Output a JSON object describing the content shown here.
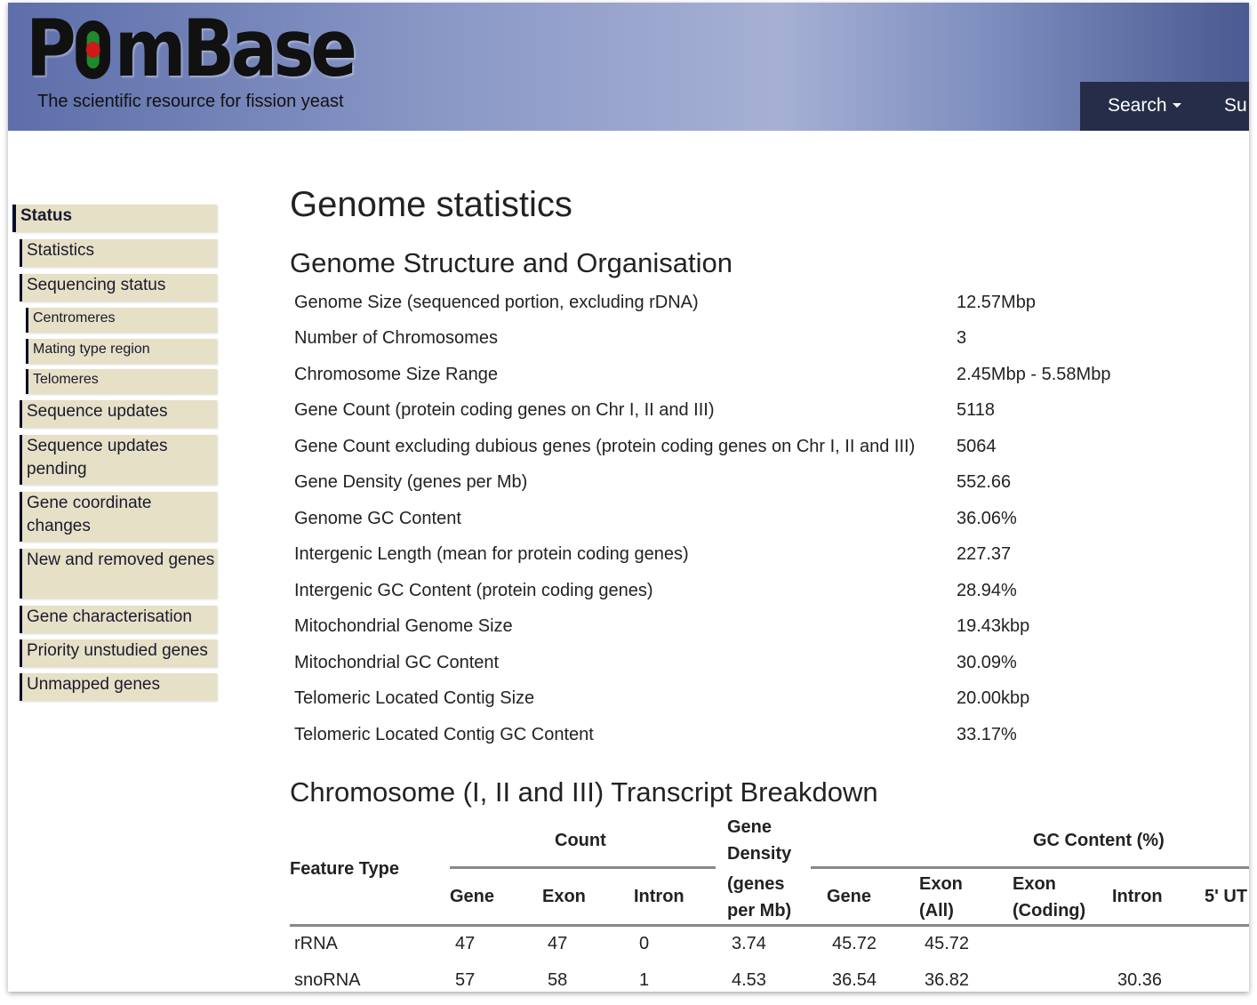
{
  "header": {
    "logo_prefix": "P",
    "logo_suffix": "mBase",
    "tagline": "The scientific resource for fission yeast",
    "nav_search": "Search",
    "nav_next": "Su"
  },
  "sidebar": {
    "items": [
      {
        "label": "Status"
      },
      {
        "label": "Statistics"
      },
      {
        "label": "Sequencing status"
      },
      {
        "label": "Centromeres"
      },
      {
        "label": "Mating type region"
      },
      {
        "label": "Telomeres"
      },
      {
        "label": "Sequence updates"
      },
      {
        "label": "Sequence updates pending"
      },
      {
        "label": "Gene coordinate changes"
      },
      {
        "label": "New and removed genes"
      },
      {
        "label": "Gene characterisation"
      },
      {
        "label": "Priority unstudied genes"
      },
      {
        "label": "Unmapped genes"
      }
    ]
  },
  "page": {
    "title": "Genome statistics",
    "section1_title": "Genome Structure and Organisation",
    "section2_title": "Chromosome (I, II and III) Transcript Breakdown"
  },
  "stats": [
    {
      "label": "Genome Size (sequenced portion, excluding rDNA)",
      "value": "12.57Mbp"
    },
    {
      "label": "Number of Chromosomes",
      "value": "3"
    },
    {
      "label": "Chromosome Size Range",
      "value": "2.45Mbp - 5.58Mbp"
    },
    {
      "label": "Gene Count (protein coding genes on Chr I, II and III)",
      "value": "5118"
    },
    {
      "label": "Gene Count excluding dubious genes (protein coding genes on Chr I, II and III)",
      "value": "5064"
    },
    {
      "label": "Gene Density (genes per Mb)",
      "value": "552.66"
    },
    {
      "label": "Genome GC Content",
      "value": "36.06%"
    },
    {
      "label": "Intergenic Length (mean for protein coding genes)",
      "value": "227.37"
    },
    {
      "label": "Intergenic GC Content (protein coding genes)",
      "value": "28.94%"
    },
    {
      "label": "Mitochondrial Genome Size",
      "value": "19.43kbp"
    },
    {
      "label": "Mitochondrial GC Content",
      "value": "30.09%"
    },
    {
      "label": "Telomeric Located Contig Size",
      "value": "20.00kbp"
    },
    {
      "label": "Telomeric Located Contig GC Content",
      "value": "33.17%"
    }
  ],
  "breakdown": {
    "headers": {
      "feature_type": "Feature Type",
      "count": "Count",
      "density_1": "Gene",
      "density_2": "Density",
      "density_3": "(genes",
      "density_4": "per Mb)",
      "gc_content": "GC Content (%)",
      "gene": "Gene",
      "exon": "Exon",
      "intron": "Intron",
      "gc_gene": "Gene",
      "gc_exon_all_1": "Exon",
      "gc_exon_all_2": "(All)",
      "gc_exon_coding_1": "Exon",
      "gc_exon_coding_2": "(Coding)",
      "gc_intron": "Intron",
      "gc_5utr": "5' UT"
    },
    "rows": [
      {
        "type": "rRNA",
        "gene": "47",
        "exon": "47",
        "intron": "0",
        "density": "3.74",
        "gc_gene": "45.72",
        "gc_exon_all": "45.72",
        "gc_exon_coding": "",
        "gc_intron": ""
      },
      {
        "type": "snoRNA",
        "gene": "57",
        "exon": "58",
        "intron": "1",
        "density": "4.53",
        "gc_gene": "36.54",
        "gc_exon_all": "36.82",
        "gc_exon_coding": "",
        "gc_intron": "30.36"
      }
    ]
  }
}
